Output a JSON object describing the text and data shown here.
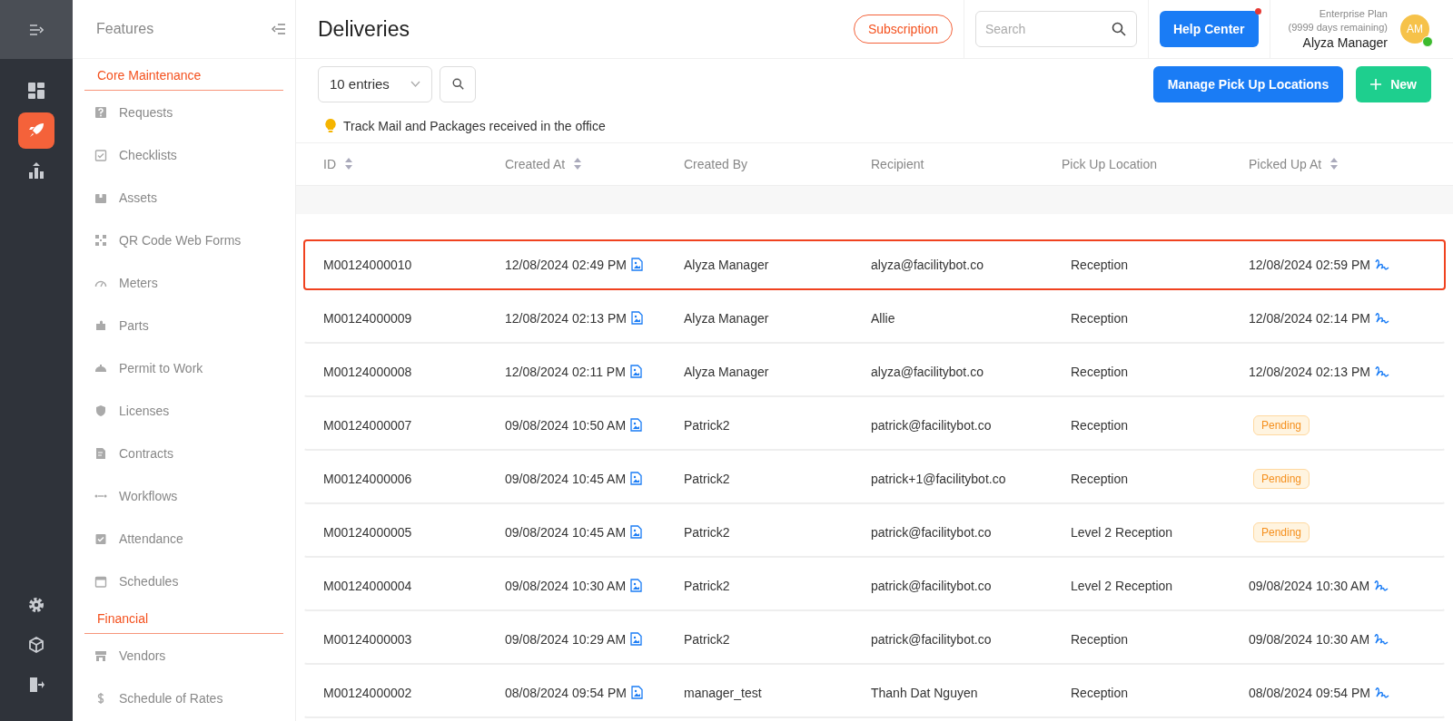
{
  "rail": {
    "top": [
      {
        "selected": false
      },
      {
        "selected": true
      },
      {
        "selected": false
      }
    ],
    "bottom": [
      {
        "selected": false
      },
      {
        "selected": false
      },
      {
        "selected": false
      }
    ]
  },
  "features": {
    "title": "Features",
    "sections": [
      {
        "title": "Core Maintenance",
        "items": [
          "Requests",
          "Checklists",
          "Assets",
          "QR Code Web Forms",
          "Meters",
          "Parts",
          "Permit to Work",
          "Licenses",
          "Contracts",
          "Workflows",
          "Attendance",
          "Schedules"
        ]
      },
      {
        "title": "Financial",
        "items": [
          "Vendors",
          "Schedule of Rates"
        ]
      }
    ]
  },
  "header": {
    "title": "Deliveries",
    "subscription": "Subscription",
    "search": {
      "placeholder": "Search"
    },
    "help": {
      "label": "Help Center",
      "notification": true
    },
    "user": {
      "plan": "Enterprise Plan",
      "remaining": "(9999 days remaining)",
      "name": "Alyza Manager",
      "initials": "AM",
      "online": true
    }
  },
  "toolbar": {
    "entries": "10 entries",
    "manage": "Manage Pick Up Locations",
    "new": "New"
  },
  "tip": "Track Mail and Packages received in the office",
  "table": {
    "columns": [
      {
        "label": "ID",
        "sortable": true
      },
      {
        "label": "Created At",
        "sortable": true
      },
      {
        "label": "Created By",
        "sortable": false
      },
      {
        "label": "Recipient",
        "sortable": false
      },
      {
        "label": "Pick Up Location",
        "sortable": false
      },
      {
        "label": "Picked Up At",
        "sortable": true
      }
    ],
    "rows": [
      {
        "id": "M00124000010",
        "created_at": "12/08/2024 02:49 PM",
        "created_by": "Alyza Manager",
        "recipient": "alyza@facilitybot.co",
        "location": "Reception",
        "picked_up": {
          "kind": "time",
          "text": "12/08/2024 02:59 PM"
        },
        "selected": true
      },
      {
        "id": "M00124000009",
        "created_at": "12/08/2024 02:13 PM",
        "created_by": "Alyza Manager",
        "recipient": "Allie",
        "location": "Reception",
        "picked_up": {
          "kind": "time",
          "text": "12/08/2024 02:14 PM"
        },
        "selected": false
      },
      {
        "id": "M00124000008",
        "created_at": "12/08/2024 02:11 PM",
        "created_by": "Alyza Manager",
        "recipient": "alyza@facilitybot.co",
        "location": "Reception",
        "picked_up": {
          "kind": "time",
          "text": "12/08/2024 02:13 PM"
        },
        "selected": false
      },
      {
        "id": "M00124000007",
        "created_at": "09/08/2024 10:50 AM",
        "created_by": "Patrick2",
        "recipient": "patrick@facilitybot.co",
        "location": "Reception",
        "picked_up": {
          "kind": "pending",
          "text": "Pending"
        },
        "selected": false
      },
      {
        "id": "M00124000006",
        "created_at": "09/08/2024 10:45 AM",
        "created_by": "Patrick2",
        "recipient": "patrick+1@facilitybot.co",
        "location": "Reception",
        "picked_up": {
          "kind": "pending",
          "text": "Pending"
        },
        "selected": false
      },
      {
        "id": "M00124000005",
        "created_at": "09/08/2024 10:45 AM",
        "created_by": "Patrick2",
        "recipient": "patrick@facilitybot.co",
        "location": "Level 2 Reception",
        "picked_up": {
          "kind": "pending",
          "text": "Pending"
        },
        "selected": false
      },
      {
        "id": "M00124000004",
        "created_at": "09/08/2024 10:30 AM",
        "created_by": "Patrick2",
        "recipient": "patrick@facilitybot.co",
        "location": "Level 2 Reception",
        "picked_up": {
          "kind": "time",
          "text": "09/08/2024 10:30 AM"
        },
        "selected": false
      },
      {
        "id": "M00124000003",
        "created_at": "09/08/2024 10:29 AM",
        "created_by": "Patrick2",
        "recipient": "patrick@facilitybot.co",
        "location": "Reception",
        "picked_up": {
          "kind": "time",
          "text": "09/08/2024 10:30 AM"
        },
        "selected": false
      },
      {
        "id": "M00124000002",
        "created_at": "08/08/2024 09:54 PM",
        "created_by": "manager_test",
        "recipient": "Thanh Dat Nguyen",
        "location": "Reception",
        "picked_up": {
          "kind": "time",
          "text": "08/08/2024 09:54 PM"
        },
        "selected": false
      }
    ]
  }
}
